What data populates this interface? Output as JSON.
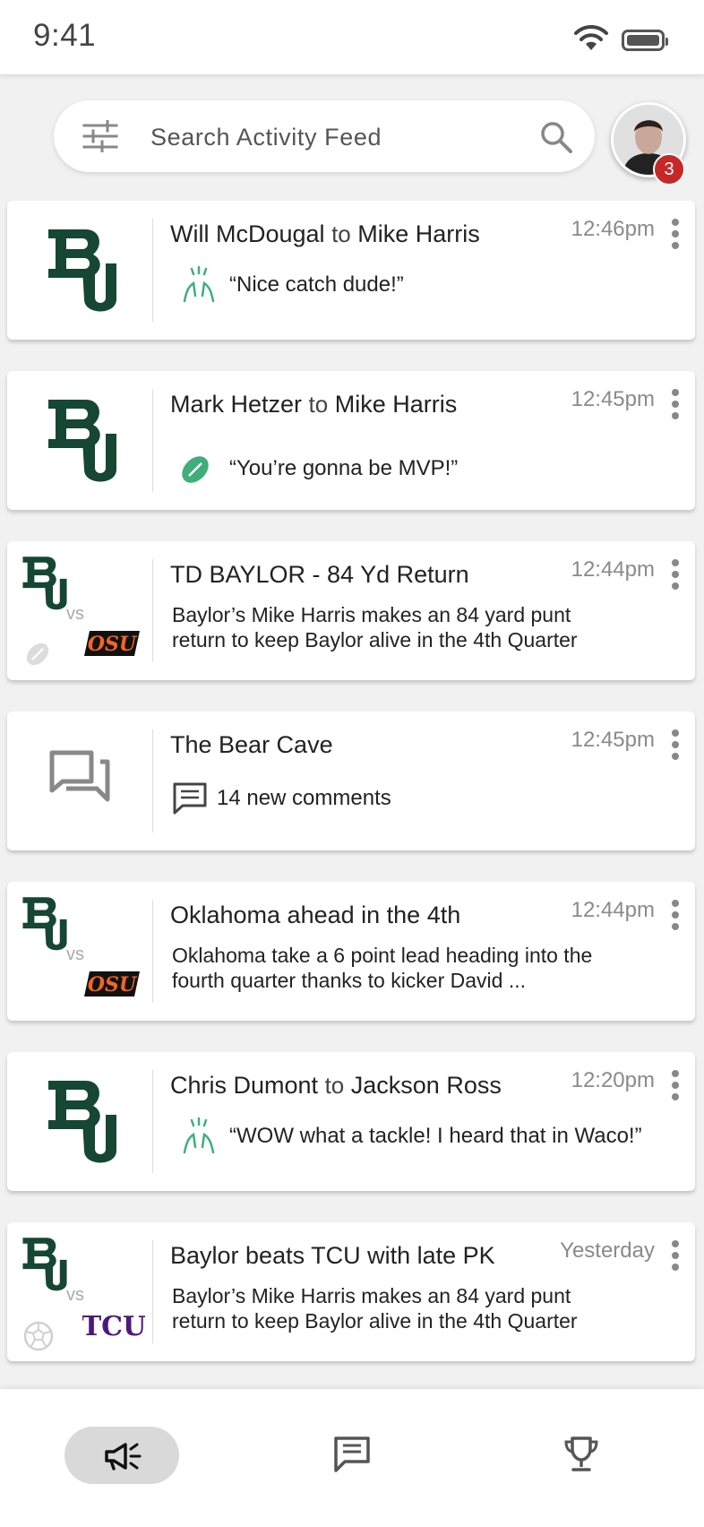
{
  "status": {
    "time": "9:41"
  },
  "search": {
    "placeholder": "Search Activity Feed"
  },
  "profile": {
    "badge_count": "3"
  },
  "feed": [
    {
      "type": "message",
      "from": "Will McDougal",
      "connector": "to",
      "to": "Mike Harris",
      "time": "12:46pm",
      "icon": "high-five-icon",
      "text": "“Nice catch dude!”"
    },
    {
      "type": "message",
      "from": "Mark Hetzer",
      "connector": "to",
      "to": "Mike Harris",
      "time": "12:45pm",
      "icon": "football-icon",
      "text": "“You’re gonna be MVP!”"
    },
    {
      "type": "game",
      "title": "TD BAYLOR - 84 Yd Return",
      "time": "12:44pm",
      "vs": "vs",
      "opponent": "OSU",
      "sport": "football",
      "text": "Baylor’s Mike Harris makes an 84 yard punt return to keep Baylor alive in the 4th Quarter"
    },
    {
      "type": "comments",
      "title": "The Bear Cave",
      "time": "12:45pm",
      "text": "14 new comments"
    },
    {
      "type": "game",
      "title": "Oklahoma ahead in the 4th",
      "time": "12:44pm",
      "vs": "vs",
      "opponent": "OSU",
      "sport": "none",
      "text": "Oklahoma take a 6 point lead heading into the fourth quarter thanks to kicker David ..."
    },
    {
      "type": "message",
      "from": "Chris Dumont",
      "connector": "to",
      "to": "Jackson Ross",
      "time": "12:20pm",
      "icon": "high-five-icon",
      "text": "“WOW what a tackle! I heard that in Waco!”"
    },
    {
      "type": "game",
      "title": "Baylor beats TCU with late PK",
      "time": "Yesterday",
      "vs": "vs",
      "opponent": "TCU",
      "sport": "soccer",
      "text": "Baylor’s Mike Harris makes an 84 yard punt return to keep Baylor alive in the 4th Quarter"
    }
  ],
  "nav": {
    "items": [
      "megaphone-icon",
      "chat-icon",
      "trophy-icon"
    ]
  },
  "colors": {
    "baylor_green": "#154734",
    "high_five_green": "#3fae7a",
    "osu_orange": "#f26522",
    "tcu_purple": "#4d1979",
    "badge_red": "#c62828"
  }
}
